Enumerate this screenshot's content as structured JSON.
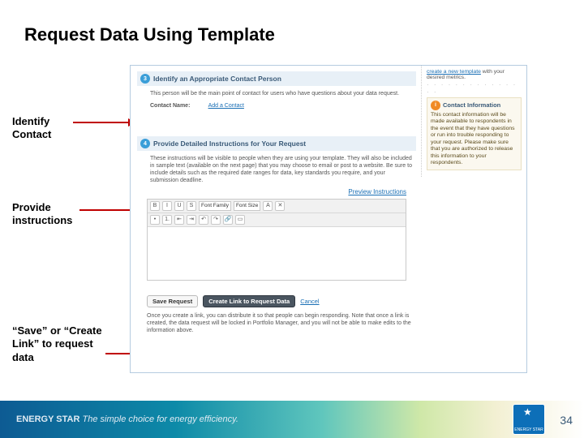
{
  "title": "Request Data Using Template",
  "callouts": {
    "identify": "Identify\nContact",
    "provide": "Provide\ninstructions",
    "save": "“Save” or “Create Link” to request data"
  },
  "app": {
    "step3": {
      "num": "3",
      "title": "Identify an Appropriate Contact Person",
      "help": "This person will be the main point of contact for users who have questions about your data request.",
      "label": "Contact Name:",
      "link": "Add a Contact"
    },
    "step4": {
      "num": "4",
      "title": "Provide Detailed Instructions for Your Request",
      "help": "These instructions will be visible to people when they are using your template. They will also be included in sample text (available on the next page) that you may choose to email or post to a website. Be sure to include details such as the required date ranges for data, key standards you require, and your submission deadline.",
      "preview": "Preview Instructions"
    },
    "toolbar": {
      "font_family": "Font Family",
      "font_size": "Font Size"
    },
    "buttons": {
      "save": "Save Request",
      "create": "Create Link to Request Data",
      "cancel": "Cancel"
    },
    "post_note": "Once you create a link, you can distribute it so that people can begin responding. Note that once a link is created, the data request will be locked in Portfolio Manager, and you will not be able to make edits to the information above.",
    "side": {
      "top": "create a new template with your desired metrics.",
      "card_title": "Contact Information",
      "card_body": "This contact information will be made available to respondents in the event that they have questions or run into trouble responding to your request. Please make sure that you are authorized to release this information to your respondents."
    }
  },
  "footer": {
    "brand": "ENERGY STAR",
    "tagline": "The simple choice for energy efficiency.",
    "logo": "ENERGY STAR"
  },
  "page": "34"
}
